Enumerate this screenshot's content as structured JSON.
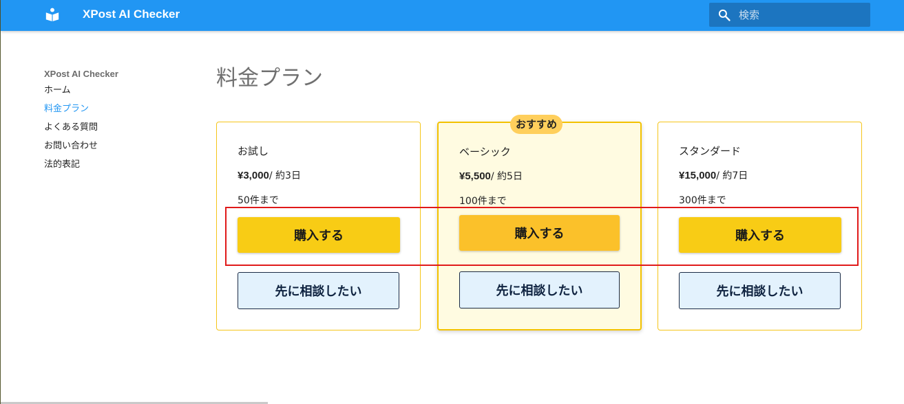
{
  "header": {
    "app_title": "XPost AI Checker",
    "search_placeholder": "検索",
    "logo_icon": "book-reader-icon",
    "search_icon": "search-icon"
  },
  "sidebar": {
    "site_name": "XPost AI Checker",
    "items": [
      {
        "label": "ホーム",
        "active": false
      },
      {
        "label": "料金プラン",
        "active": true
      },
      {
        "label": "よくある質問",
        "active": false
      },
      {
        "label": "お問い合わせ",
        "active": false
      },
      {
        "label": "法的表記",
        "active": false
      }
    ]
  },
  "main": {
    "title": "料金プラン",
    "plans": [
      {
        "name": "お試し",
        "price": "¥3,000",
        "period": "/ 約3日",
        "limit": "50件まで",
        "buy_label": "購入する",
        "consult_label": "先に相談したい",
        "recommended": false
      },
      {
        "name": "ベーシック",
        "price": "¥5,500",
        "period": "/ 約5日",
        "limit": "100件まで",
        "buy_label": "購入する",
        "consult_label": "先に相談したい",
        "recommended": true,
        "badge": "おすすめ"
      },
      {
        "name": "スタンダード",
        "price": "¥15,000",
        "period": "/ 約7日",
        "limit": "300件まで",
        "buy_label": "購入する",
        "consult_label": "先に相談したい",
        "recommended": false
      }
    ]
  },
  "colors": {
    "header": "#2196f3",
    "accent_link": "#2196f3",
    "buy_button": "#f8cc15",
    "recommended_background": "#fffbe1",
    "consult_button": "#e3f2fd",
    "highlight_box": "#e01919"
  }
}
